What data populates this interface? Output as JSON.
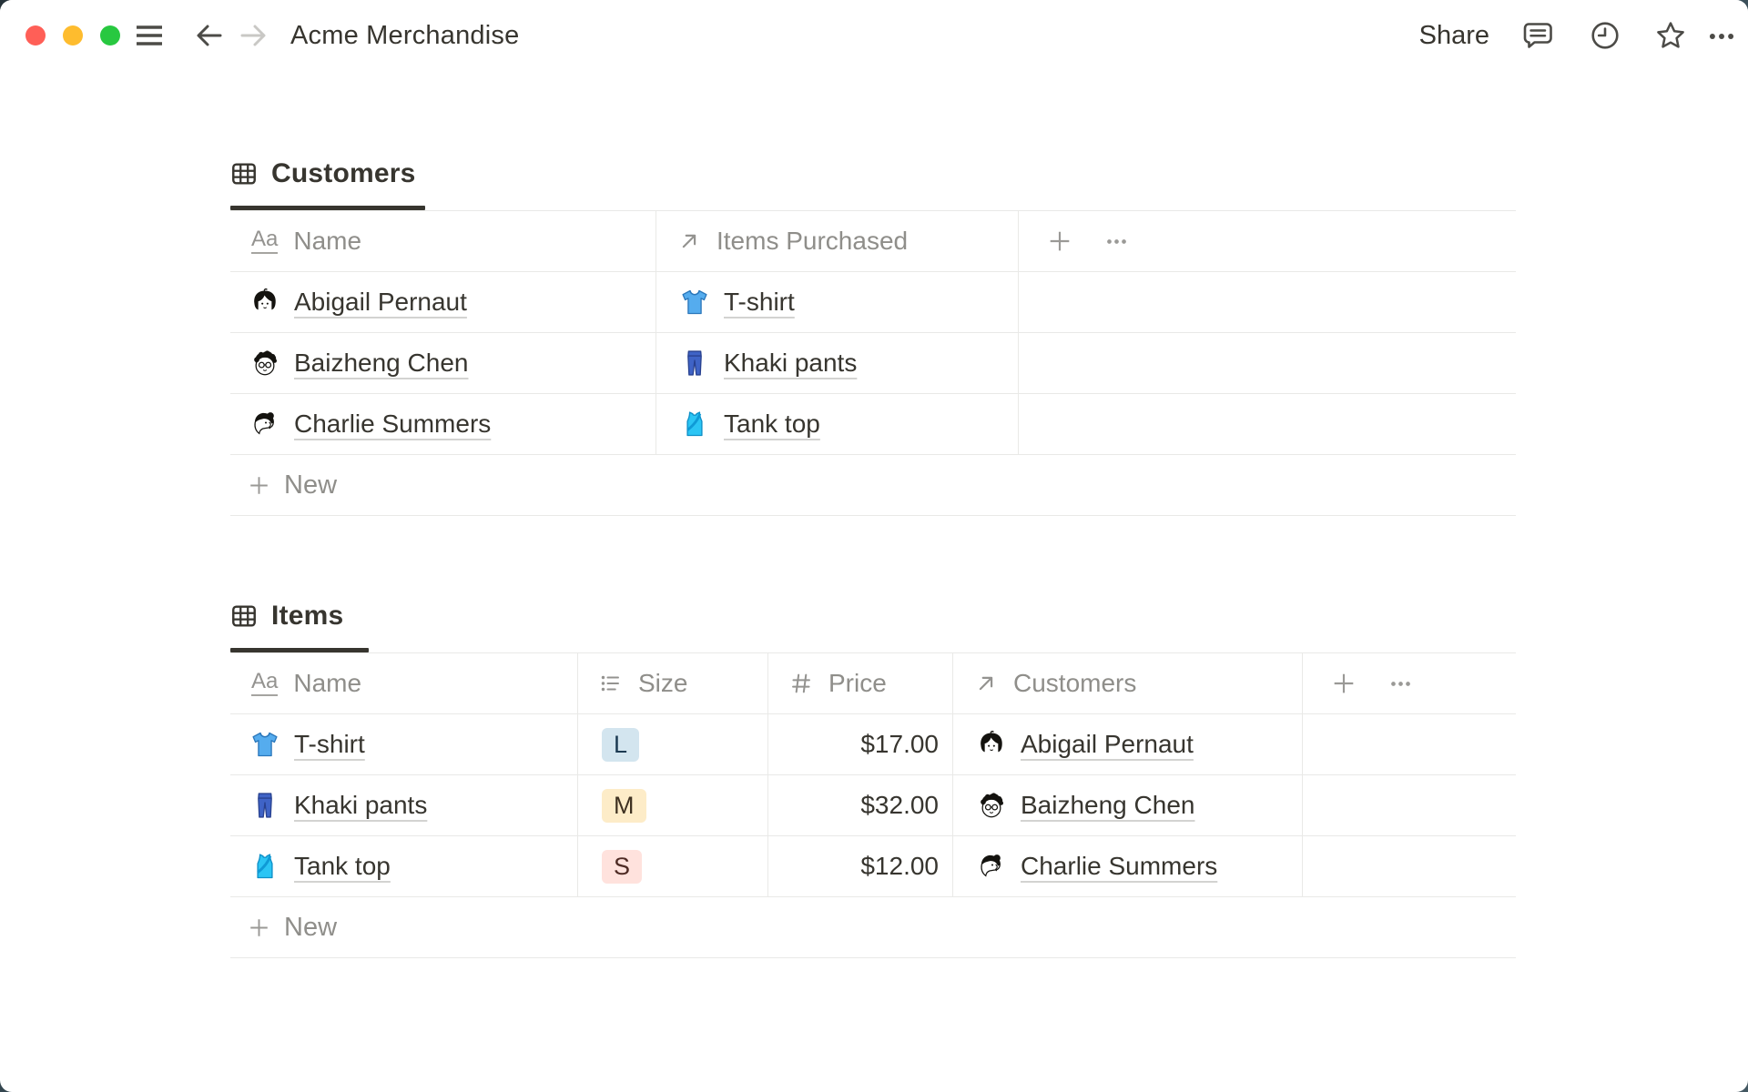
{
  "window": {
    "title": "Acme Merchandise"
  },
  "titlebar": {
    "share_label": "Share",
    "icons": [
      "menu-icon",
      "back-arrow-icon",
      "forward-arrow-icon",
      "comment-icon",
      "clock-icon",
      "star-icon",
      "more-icon"
    ],
    "traffic_lights": [
      "close",
      "minimize",
      "zoom"
    ]
  },
  "property_icon_glyphs": {
    "title": "Aa"
  },
  "customers_table": {
    "tab_label": "Customers",
    "columns": {
      "name": "Name",
      "items_purchased": "Items Purchased"
    },
    "column_types": {
      "name": "title",
      "items_purchased": "relation"
    },
    "rows": [
      {
        "name": "Abigail Pernaut",
        "avatar": "avatar-abigail",
        "item": "T-shirt",
        "item_icon": "tshirt-emoji"
      },
      {
        "name": "Baizheng Chen",
        "avatar": "avatar-baizheng",
        "item": "Khaki pants",
        "item_icon": "jeans-emoji"
      },
      {
        "name": "Charlie Summers",
        "avatar": "avatar-charlie",
        "item": "Tank top",
        "item_icon": "tank-top-emoji"
      }
    ],
    "new_label": "New"
  },
  "items_table": {
    "tab_label": "Items",
    "columns": {
      "name": "Name",
      "size": "Size",
      "price": "Price",
      "customers": "Customers"
    },
    "column_types": {
      "name": "title",
      "size": "select",
      "price": "number",
      "customers": "relation"
    },
    "rows": [
      {
        "name": "T-shirt",
        "item_icon": "tshirt-emoji",
        "size": "L",
        "size_color": "blue",
        "price": "$17.00",
        "customer": "Abigail Pernaut",
        "avatar": "avatar-abigail"
      },
      {
        "name": "Khaki pants",
        "item_icon": "jeans-emoji",
        "size": "M",
        "size_color": "yellow",
        "price": "$32.00",
        "customer": "Baizheng Chen",
        "avatar": "avatar-baizheng"
      },
      {
        "name": "Tank top",
        "item_icon": "tank-top-emoji",
        "size": "S",
        "size_color": "red",
        "price": "$12.00",
        "customer": "Charlie Summers",
        "avatar": "avatar-charlie"
      }
    ],
    "new_label": "New"
  },
  "colors": {
    "traffic_red": "#ff5f57",
    "traffic_yellow": "#febc2e",
    "traffic_green": "#28c840",
    "text": "#37352f",
    "secondary_text": "#8f8e8a",
    "border": "#e9e9e7",
    "tab_underline": "#37352f",
    "badge_blue_bg": "#d3e5ef",
    "badge_yellow_bg": "#fdecc8",
    "badge_red_bg": "#ffe2dd"
  }
}
